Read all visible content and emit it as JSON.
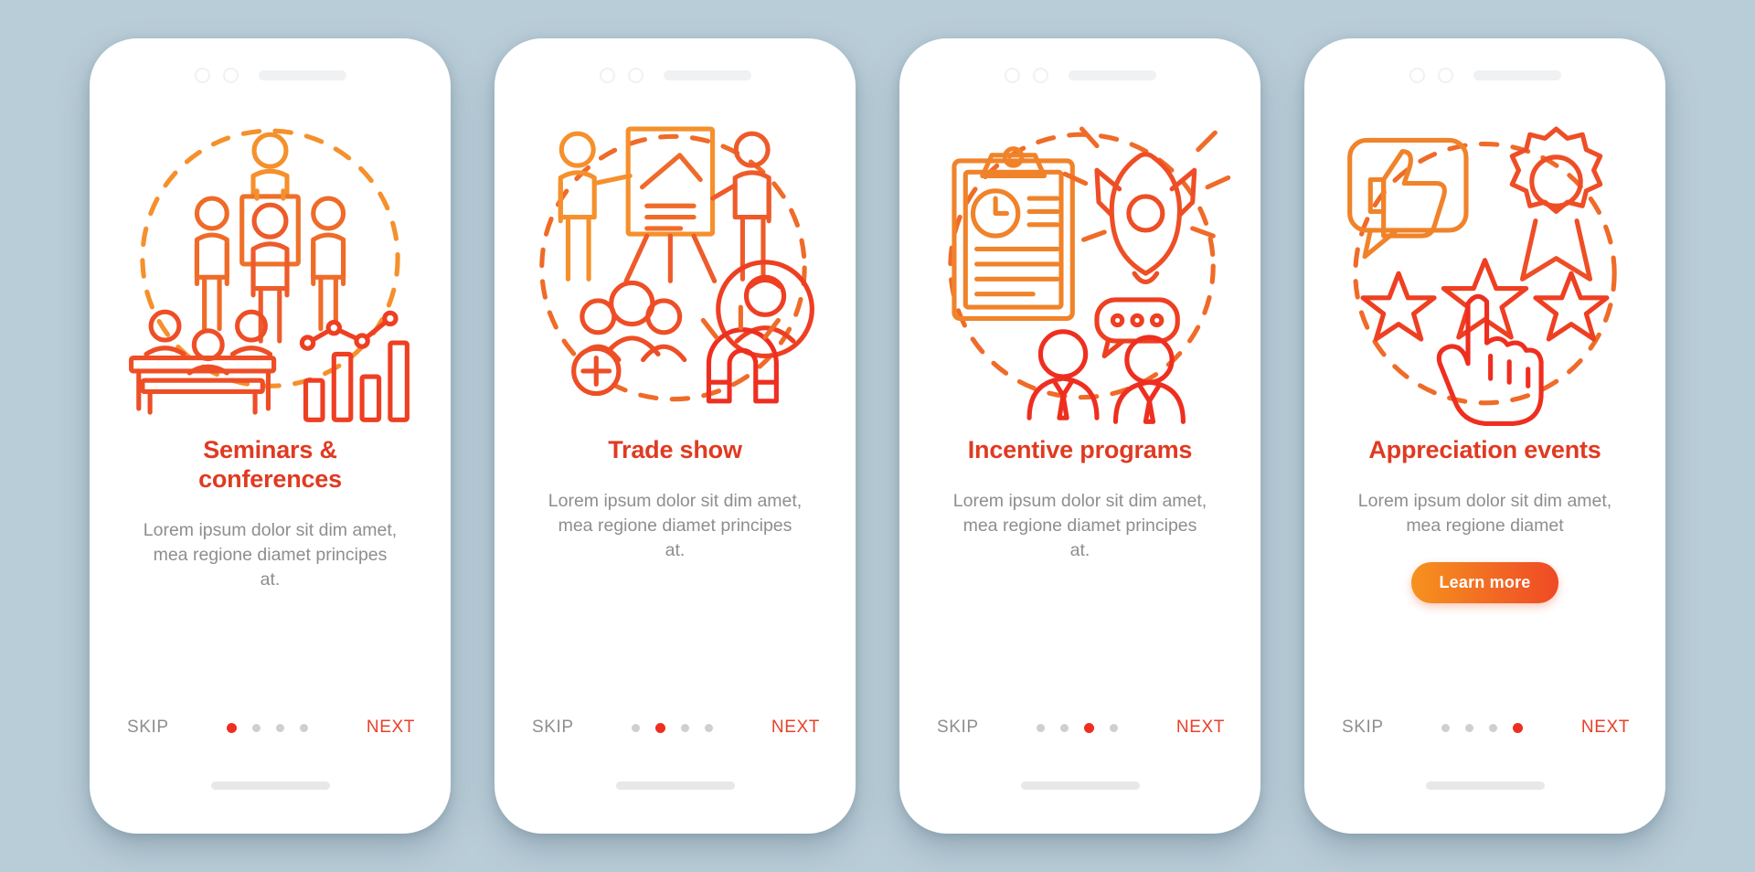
{
  "background_color": "#b9cdd8",
  "theme": {
    "title_color": "#e03a21",
    "body_color": "#8e8e8e",
    "accent_red": "#ee2f20",
    "accent_orange": "#f6921e",
    "dot_inactive": "#cfcfcf",
    "next_color": "#e8402a"
  },
  "nav_labels": {
    "skip": "SKIP",
    "next": "NEXT"
  },
  "screens": [
    {
      "id": "seminars-conferences",
      "title": "Seminars & conferences",
      "description": "Lorem ipsum dolor sit dim amet, mea regione diamet principes at.",
      "illustration": "seminar-audience-chart-illustration",
      "skip": "SKIP",
      "next": "NEXT",
      "active_dot": 1,
      "dot_count": 4,
      "cta": null
    },
    {
      "id": "trade-show",
      "title": "Trade show",
      "description": "Lorem ipsum dolor sit dim amet, mea regione diamet principes at.",
      "illustration": "presentation-magnet-people-illustration",
      "skip": "SKIP",
      "next": "NEXT",
      "active_dot": 2,
      "dot_count": 4,
      "cta": null
    },
    {
      "id": "incentive-programs",
      "title": "Incentive programs",
      "description": "Lorem ipsum dolor sit dim amet, mea regione diamet principes at.",
      "illustration": "clipboard-rocket-team-illustration",
      "skip": "SKIP",
      "next": "NEXT",
      "active_dot": 3,
      "dot_count": 4,
      "cta": null
    },
    {
      "id": "appreciation-events",
      "title": "Appreciation events",
      "description": "Lorem ipsum dolor sit dim amet, mea regione diamet",
      "illustration": "thumbsup-award-stars-illustration",
      "skip": "SKIP",
      "next": "NEXT",
      "active_dot": 4,
      "dot_count": 4,
      "cta": "Learn more"
    }
  ]
}
